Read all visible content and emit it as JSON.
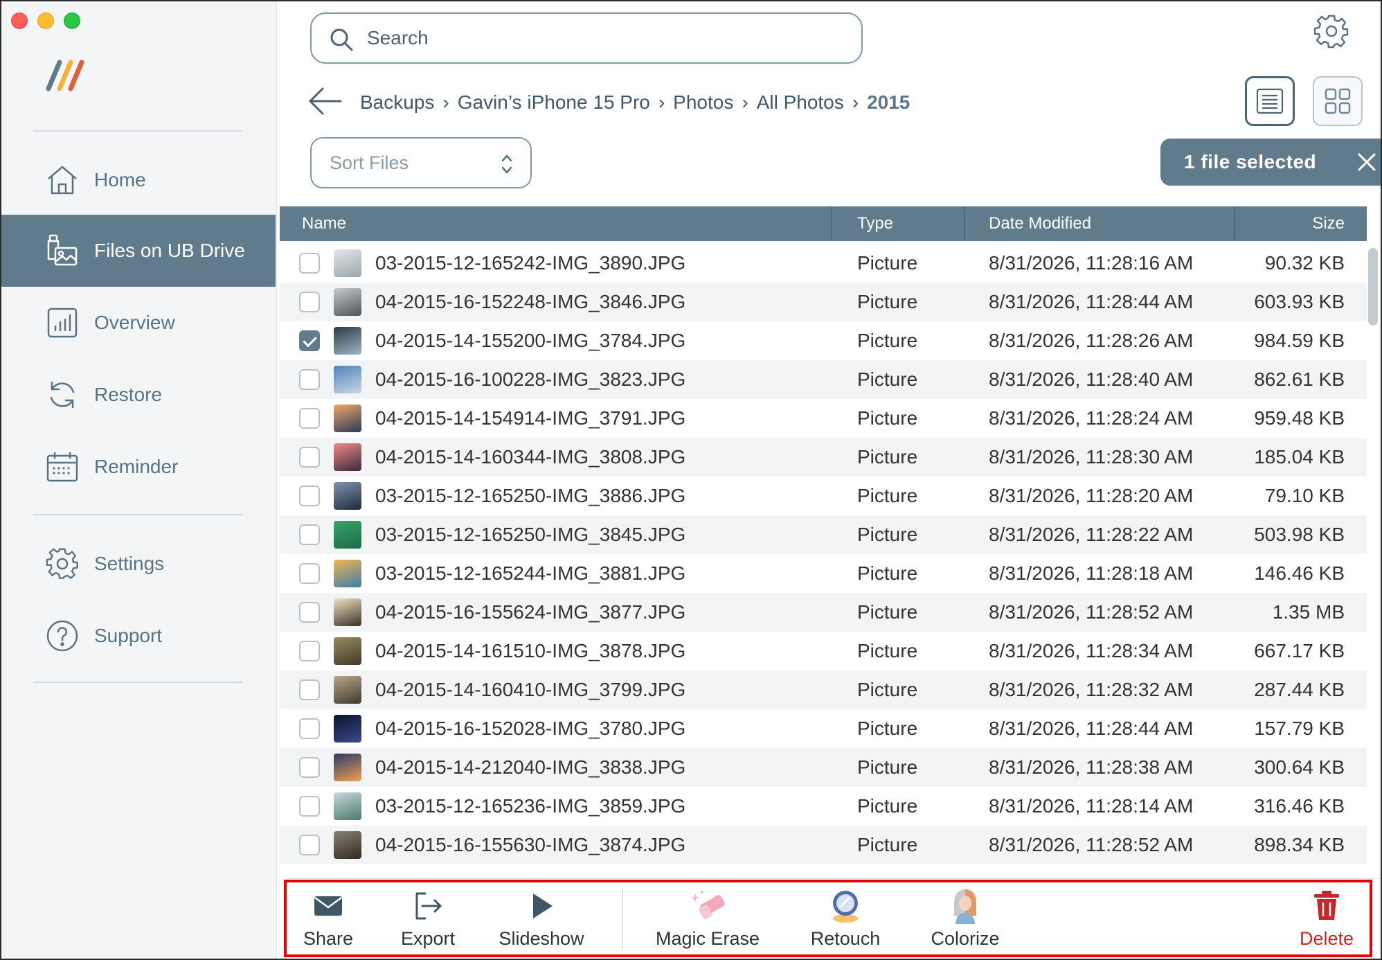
{
  "window": {
    "traffic_lights": [
      "close",
      "minimize",
      "zoom"
    ]
  },
  "sidebar": {
    "items": [
      {
        "label": "Home",
        "icon": "home-icon",
        "active": false
      },
      {
        "label": "Files on UB Drive",
        "icon": "drive-photos-icon",
        "active": true
      },
      {
        "label": "Overview",
        "icon": "chart-icon",
        "active": false
      },
      {
        "label": "Restore",
        "icon": "restore-icon",
        "active": false
      },
      {
        "label": "Reminder",
        "icon": "calendar-icon",
        "active": false
      },
      {
        "label": "Settings",
        "icon": "gear-icon",
        "active": false
      },
      {
        "label": "Support",
        "icon": "help-icon",
        "active": false
      }
    ]
  },
  "header": {
    "search_placeholder": "Search",
    "sort_placeholder": "Sort Files",
    "selected_label": "1 file selected",
    "breadcrumb": [
      "Backups",
      "Gavin’s iPhone 15 Pro",
      "Photos",
      "All Photos",
      "2015"
    ]
  },
  "table": {
    "columns": {
      "name": "Name",
      "type": "Type",
      "date": "Date Modified",
      "size": "Size"
    },
    "rows": [
      {
        "name": "03-2015-12-165242-IMG_3890.JPG",
        "type": "Picture",
        "date": "8/31/2026, 11:28:16 AM",
        "size": "90.32 KB",
        "checked": false,
        "thumb": [
          "#e4e8ea",
          "#9aa5aa"
        ]
      },
      {
        "name": "04-2015-16-152248-IMG_3846.JPG",
        "type": "Picture",
        "date": "8/31/2026, 11:28:44 AM",
        "size": "603.93 KB",
        "checked": false,
        "thumb": [
          "#c8cacc",
          "#4e5458"
        ]
      },
      {
        "name": "04-2015-14-155200-IMG_3784.JPG",
        "type": "Picture",
        "date": "8/31/2026, 11:28:26 AM",
        "size": "984.59 KB",
        "checked": true,
        "thumb": [
          "#2c3a48",
          "#9fb4c6"
        ]
      },
      {
        "name": "04-2015-16-100228-IMG_3823.JPG",
        "type": "Picture",
        "date": "8/31/2026, 11:28:40 AM",
        "size": "862.61 KB",
        "checked": false,
        "thumb": [
          "#4f82b8",
          "#c9d8e4"
        ]
      },
      {
        "name": "04-2015-14-154914-IMG_3791.JPG",
        "type": "Picture",
        "date": "8/31/2026, 11:28:24 AM",
        "size": "959.48 KB",
        "checked": false,
        "thumb": [
          "#f0a66a",
          "#2c3a56"
        ]
      },
      {
        "name": "04-2015-14-160344-IMG_3808.JPG",
        "type": "Picture",
        "date": "8/31/2026, 11:28:30 AM",
        "size": "185.04 KB",
        "checked": false,
        "thumb": [
          "#f08a8a",
          "#3c2a3a"
        ]
      },
      {
        "name": "03-2015-12-165250-IMG_3886.JPG",
        "type": "Picture",
        "date": "8/31/2026, 11:28:20 AM",
        "size": "79.10 KB",
        "checked": false,
        "thumb": [
          "#7f93ad",
          "#1f2b3e"
        ]
      },
      {
        "name": "03-2015-12-165250-IMG_3845.JPG",
        "type": "Picture",
        "date": "8/31/2026, 11:28:22 AM",
        "size": "503.98 KB",
        "checked": false,
        "thumb": [
          "#3aa36a",
          "#1b6b49"
        ]
      },
      {
        "name": "03-2015-12-165244-IMG_3881.JPG",
        "type": "Picture",
        "date": "8/31/2026, 11:28:18 AM",
        "size": "146.46 KB",
        "checked": false,
        "thumb": [
          "#f2b552",
          "#3a7ea8"
        ]
      },
      {
        "name": "04-2015-16-155624-IMG_3877.JPG",
        "type": "Picture",
        "date": "8/31/2026, 11:28:52 AM",
        "size": "1.35 MB",
        "checked": false,
        "thumb": [
          "#f1e2c4",
          "#3b3226"
        ]
      },
      {
        "name": "04-2015-14-161510-IMG_3878.JPG",
        "type": "Picture",
        "date": "8/31/2026, 11:28:34 AM",
        "size": "667.17 KB",
        "checked": false,
        "thumb": [
          "#9a8a60",
          "#3e3a2a"
        ]
      },
      {
        "name": "04-2015-14-160410-IMG_3799.JPG",
        "type": "Picture",
        "date": "8/31/2026, 11:28:32 AM",
        "size": "287.44 KB",
        "checked": false,
        "thumb": [
          "#b9a88a",
          "#3f3a2e"
        ]
      },
      {
        "name": "04-2015-16-152028-IMG_3780.JPG",
        "type": "Picture",
        "date": "8/31/2026, 11:28:44 AM",
        "size": "157.79 KB",
        "checked": false,
        "thumb": [
          "#0c1230",
          "#3a4a8a"
        ]
      },
      {
        "name": "04-2015-14-212040-IMG_3838.JPG",
        "type": "Picture",
        "date": "8/31/2026, 11:28:38 AM",
        "size": "300.64 KB",
        "checked": false,
        "thumb": [
          "#2a3a6a",
          "#f0a050"
        ]
      },
      {
        "name": "03-2015-12-165236-IMG_3859.JPG",
        "type": "Picture",
        "date": "8/31/2026, 11:28:14 AM",
        "size": "316.46 KB",
        "checked": false,
        "thumb": [
          "#c8d8dc",
          "#4a7a6a"
        ]
      },
      {
        "name": "04-2015-16-155630-IMG_3874.JPG",
        "type": "Picture",
        "date": "8/31/2026, 11:28:52 AM",
        "size": "898.34 KB",
        "checked": false,
        "thumb": [
          "#8a8272",
          "#2e2a24"
        ]
      }
    ]
  },
  "toolbar": {
    "items": [
      {
        "label": "Share",
        "icon": "envelope-icon"
      },
      {
        "label": "Export",
        "icon": "export-icon"
      },
      {
        "label": "Slideshow",
        "icon": "play-icon"
      },
      {
        "label": "Magic Erase",
        "icon": "eraser-icon"
      },
      {
        "label": "Retouch",
        "icon": "compact-mirror-icon"
      },
      {
        "label": "Colorize",
        "icon": "portrait-icon"
      },
      {
        "label": "Delete",
        "icon": "trash-icon"
      }
    ],
    "highlight_color": "#e60000",
    "delete_color": "#c62828"
  },
  "colors": {
    "accent": "#5f7b8c",
    "sidebar_bg": "#f4f5f6"
  }
}
